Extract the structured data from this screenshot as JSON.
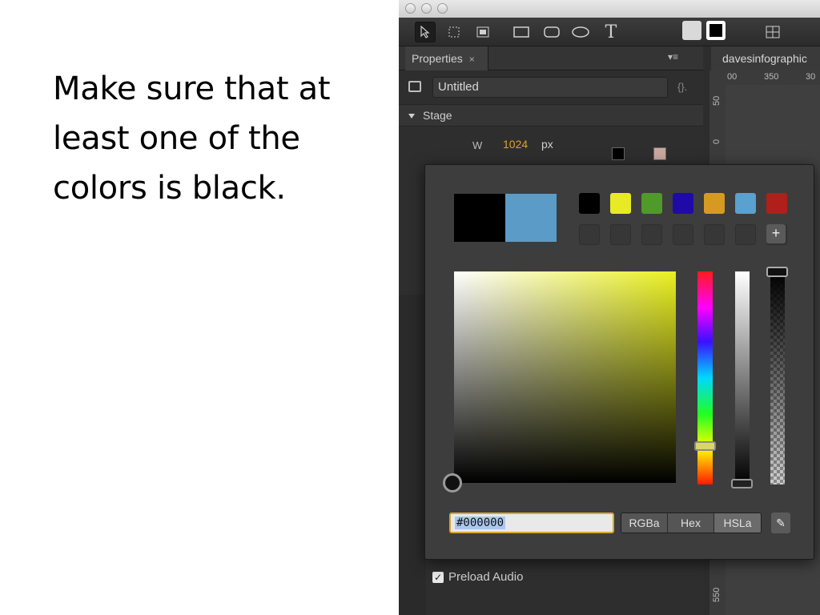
{
  "slide": {
    "instruction": "Make sure that at least one of the colors is black."
  },
  "app": {
    "panel_tab": "Properties",
    "panel_tab_close": "×",
    "panel_menu": "▾≡",
    "document_tab": "davesinfographic",
    "composition_name": "Untitled",
    "braces": "{}.",
    "stage_section": "Stage",
    "width_label": "W",
    "width_value": "1024",
    "width_unit": "px",
    "preload_audio": "Preload Audio",
    "ruler_h": [
      "00",
      "350",
      "30"
    ],
    "ruler_v": [
      "50",
      "0",
      "550"
    ]
  },
  "picker": {
    "previous_color": "#000000",
    "new_color": "#5b9bc8",
    "preset_colors": [
      "#000000",
      "#e8ea26",
      "#4f9a2a",
      "#1f0aa8",
      "#d69a22",
      "#5aa0d0",
      "#b01f1a"
    ],
    "empty_slots": 7,
    "add_label": "+",
    "hex_value": "#000000",
    "modes": [
      "RGBa",
      "Hex",
      "HSLa"
    ],
    "eyedropper": "✎"
  }
}
